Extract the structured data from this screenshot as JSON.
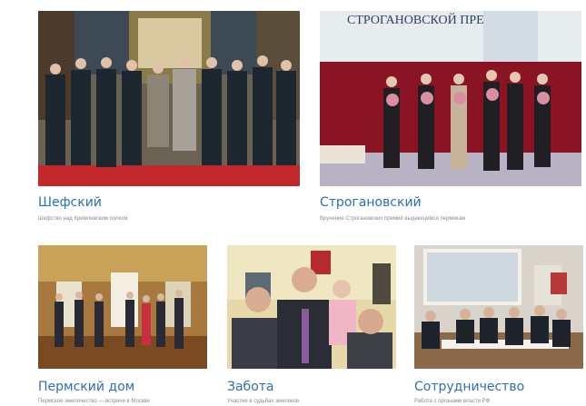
{
  "cards": [
    {
      "title": "Шефский",
      "caption": "Шефство над Кремлевским полком",
      "photo": "ceremony-group-photo"
    },
    {
      "title": "Строгановский",
      "caption": "Вручение Строгановских премий выдающимся пермякам",
      "photo": "award-stage-photo",
      "banner": "СТРОГАНОВСКОЙ ПРЕМИИ"
    },
    {
      "title": "Пермский дом",
      "caption": "Пермское землячество — встречи в Москве",
      "photo": "hall-gathering-photo"
    },
    {
      "title": "Забота",
      "caption": "Участие в судьбах земляков",
      "photo": "family-photo"
    },
    {
      "title": "Сотрудничество",
      "caption": "Работа с органами власти РФ",
      "photo": "conference-photo"
    }
  ],
  "colors": {
    "link": "#2f6fb0",
    "caption": "#8a8a8a"
  }
}
